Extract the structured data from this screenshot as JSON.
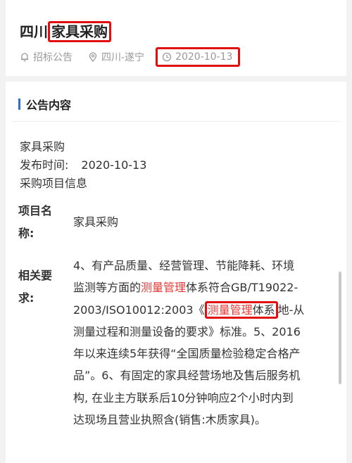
{
  "header": {
    "title_prefix": "四川",
    "title_highlight": "家具采购",
    "category": "招标公告",
    "location": "四川-遂宁",
    "date": "2020-10-13"
  },
  "section": {
    "title": "公告内容"
  },
  "intro": {
    "line1": "家具采购",
    "date_label": "发布时间:",
    "date_value": "2020-10-13",
    "line3": "采购项目信息"
  },
  "project": {
    "label_line1": "项目名",
    "label_line2": "称:",
    "value": "家具采购"
  },
  "requirements": {
    "label_line1": "相关要",
    "label_line2": "求:",
    "l1": "4、有产品质量、经营管理、节能降耗、环境",
    "l2_a": "监测等方面的",
    "l2_red": "测量管理",
    "l2_b": "体系符合GB/T19022-",
    "l3_a": "2003/ISO10012:2003《",
    "l3_red": "测量管理",
    "l3_hl": "体系",
    "l3_b": "地-从",
    "l4": "测量过程和测量设备的要求》标准。5、2016",
    "l5": "年以来连续5年获得“全国质量检验稳定合格产",
    "l6": "品”。6、有固定的家具经营场地及售后服务机",
    "l7": "构, 在业主方联系后10分钟响应2个小时内到",
    "l8": "达现场且营业执照含(销售:木质家具)。"
  },
  "colors": {
    "highlight_box": "#e01010",
    "keyword_red": "#e53935",
    "section_accent": "#2a6fd6"
  },
  "icons": {
    "category": "bell-icon",
    "location": "location-pin-icon",
    "date": "clock-icon"
  }
}
